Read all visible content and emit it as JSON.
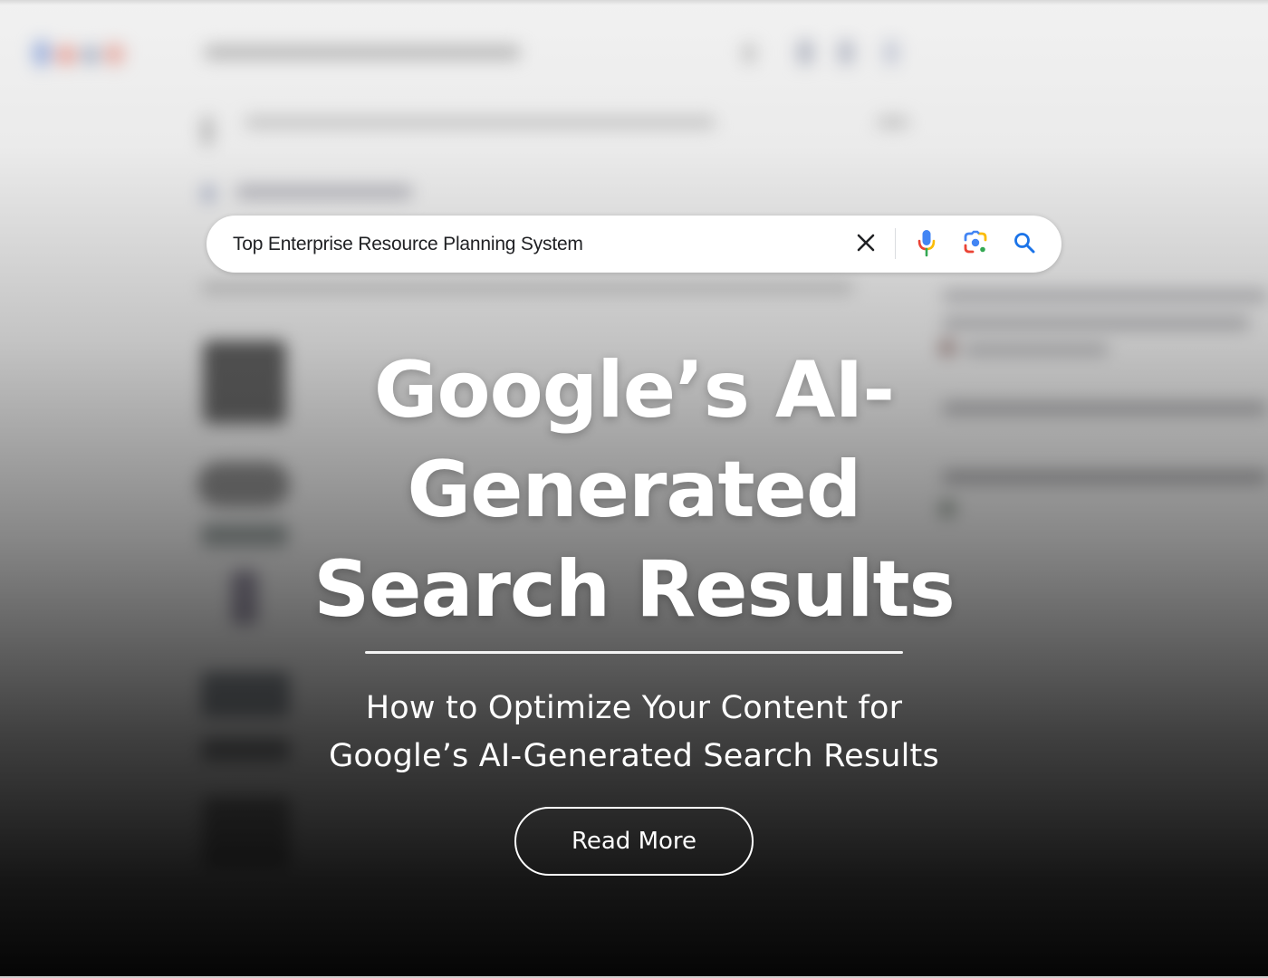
{
  "search": {
    "query": "Top Enterprise Resource Planning System",
    "icons": {
      "clear": "close-icon",
      "voice": "microphone-icon",
      "lens": "google-lens-icon",
      "search": "search-icon"
    }
  },
  "hero": {
    "title_lines": [
      "Google’s AI-",
      "Generated",
      "Search Results"
    ],
    "subtitle_lines": [
      "How to Optimize Your Content for",
      "Google’s AI-Generated Search Results"
    ],
    "cta_label": "Read More"
  },
  "colors": {
    "google_blue": "#4285f4",
    "google_red": "#ea4335",
    "google_yellow": "#fbbc05",
    "google_green": "#34a853",
    "search_blue": "#1a73e8",
    "text_white": "#ffffff"
  }
}
